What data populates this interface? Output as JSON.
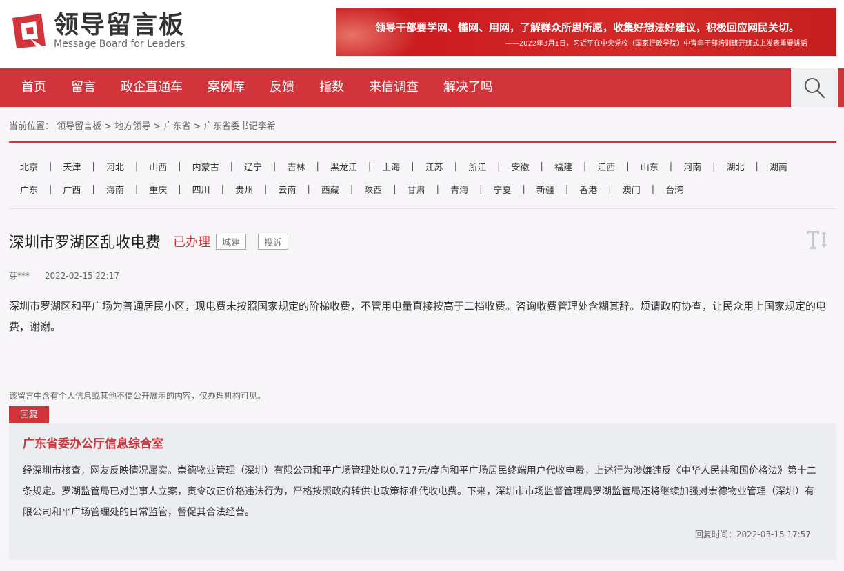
{
  "header": {
    "logo_cn": "领导留言板",
    "logo_en": "Message Board for Leaders",
    "banner_quote": "领导干部要学网、懂网、用网，了解群众所思所愿，收集好想法好建议，积极回应网民关切。",
    "banner_source": "——2022年3月1日，习近平在中央党校（国家行政学院）中青年干部培训班开班式上发表重要讲话"
  },
  "nav": {
    "items": [
      {
        "label": "首页"
      },
      {
        "label": "留言"
      },
      {
        "label": "政企直通车"
      },
      {
        "label": "案例库"
      },
      {
        "label": "反馈"
      },
      {
        "label": "指数"
      },
      {
        "label": "来信调查"
      },
      {
        "label": "解决了吗"
      }
    ],
    "search_icon": "search-icon"
  },
  "breadcrumb": {
    "prefix": "当前位置：",
    "items": [
      "领导留言板",
      "地方领导",
      "广东省",
      "广东省委书记李希"
    ],
    "separator": ">"
  },
  "provinces": {
    "row1": [
      "北京",
      "天津",
      "河北",
      "山西",
      "内蒙古",
      "辽宁",
      "吉林",
      "黑龙江",
      "上海",
      "江苏",
      "浙江",
      "安徽",
      "福建",
      "江西",
      "山东",
      "河南",
      "湖北",
      "湖南"
    ],
    "row2": [
      "广东",
      "广西",
      "海南",
      "重庆",
      "四川",
      "贵州",
      "云南",
      "西藏",
      "陕西",
      "甘肃",
      "青海",
      "宁夏",
      "新疆",
      "香港",
      "澳门",
      "台湾"
    ],
    "separator": "|"
  },
  "message": {
    "title": "深圳市罗湖区乱收电费",
    "status": "已办理",
    "tags": [
      "城建",
      "投诉"
    ],
    "author": "芽***",
    "date": "2022-02-15 22:17",
    "body": "深圳市罗湖区和平广场为普通居民小区，现电费未按照国家规定的阶梯收费，不管用电量直接按高于二档收费。咨询收费管理处含糊其辞。烦请政府协查，让民众用上国家规定的电费，谢谢。",
    "privacy_note": "该留言中含有个人信息或其他不便公开展示的内容，仅办理机构可见。",
    "font_toggle_icon": "text-size-icon"
  },
  "reply": {
    "tab_label": "回复",
    "org": "广东省委办公厅信息综合室",
    "body": "经深圳市核查，网友反映情况属实。崇德物业管理（深圳）有限公司和平广场管理处以0.717元/度向和平广场居民终端用户代收电费，上述行为涉嫌违反《中华人民共和国价格法》第十二条规定。罗湖监管局已对当事人立案，责令改正价格违法行为，严格按照政府转供电政策标准代收电费。下来，深圳市市场监督管理局罗湖监管局还将继续加强对崇德物业管理（深圳）有限公司和平广场管理处的日常监管，督促其合法经营。",
    "time_label": "回复时间：",
    "time": "2022-03-15 17:57"
  },
  "colors": {
    "brand_red": "#d2343c",
    "banner_red": "#c8161d",
    "page_bg": "#f7f5f8",
    "reply_bg": "#ecedf1"
  }
}
